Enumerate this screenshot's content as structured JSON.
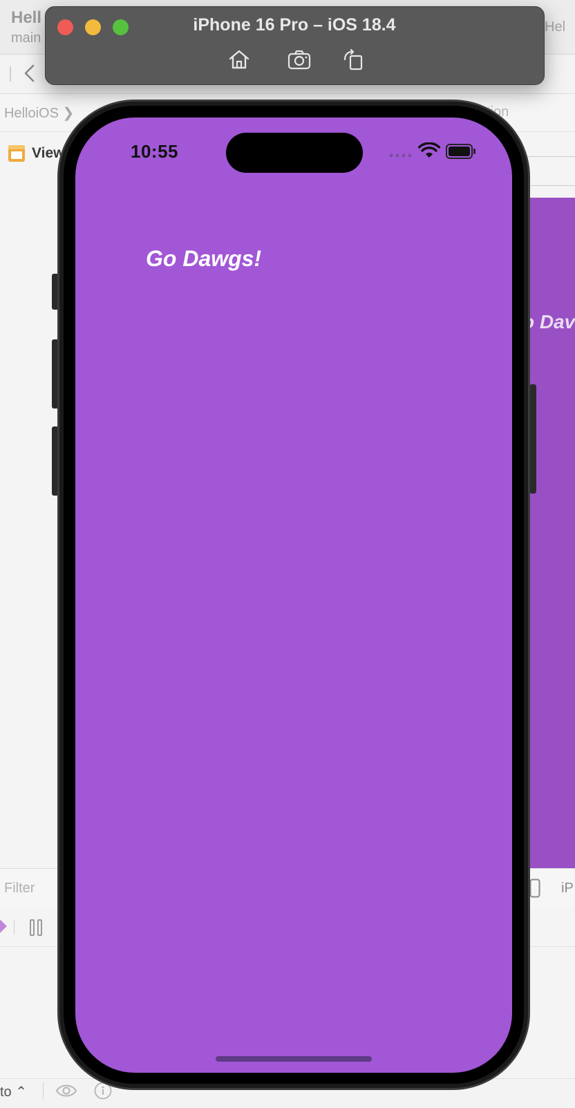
{
  "xcode": {
    "project_title": "Hell",
    "project_subtitle": "main",
    "right_tab": "Hel",
    "breadcrumb_left": "HelloiOS ❯",
    "breadcrumb_right": "tion",
    "view_label": "View",
    "canvas_preview_text": "o Dav",
    "filter_placeholder": "Filter",
    "device_label": "iP",
    "auto_label": "to ⌃"
  },
  "simulator": {
    "title": "iPhone 16 Pro – iOS 18.4",
    "toolbar": {
      "home_icon": "home-icon",
      "screenshot_icon": "camera-icon",
      "rotate_icon": "rotate-icon"
    }
  },
  "device": {
    "status_time": "10:55",
    "label_text": "Go Dawgs!",
    "background_color": "#a257d6",
    "label_color": "#ffffff"
  }
}
